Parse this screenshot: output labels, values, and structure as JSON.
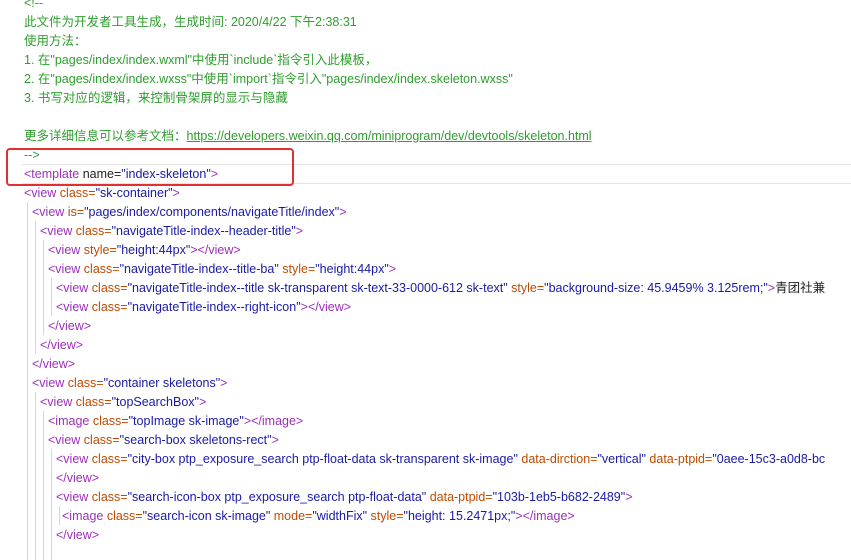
{
  "comment": {
    "open": "<!--",
    "line1": "此文件为开发者工具生成，生成时间: 2020/4/22 下午2:38:31",
    "line2": "使用方法：",
    "line3": "1. 在\"pages/index/index.wxml\"中使用`include`指令引入此模板，",
    "line4": "2. 在\"pages/index/index.wxss\"中使用`import`指令引入\"pages/index/index.skeleton.wxss\"",
    "line5": "3. 书写对应的逻辑，来控制骨架屏的显示与隐藏",
    "line6_prefix": "更多详细信息可以参考文档：",
    "line6_link": "https://developers.weixin.qq.com/miniprogram/dev/devtools/skeleton.html",
    "close": "-->"
  },
  "code": {
    "template_open": "<template",
    "template_attr": " name=",
    "template_value": "\"index-skeleton\"",
    "template_end": ">",
    "l1_tag": "<view",
    "l1_attr": " class=",
    "l1_val": "\"sk-container\"",
    "l1_end": ">",
    "l2_tag": "<view",
    "l2_attr": " is=",
    "l2_val": "\"pages/index/components/navigateTitle/index\"",
    "l2_end": ">",
    "l3_tag": "<view",
    "l3_attr": " class=",
    "l3_val": "\"navigateTitle-index--header-title\"",
    "l3_end": ">",
    "l4_tag": "<view",
    "l4_attr": " style=",
    "l4_val": "\"height:44px\"",
    "l4_end": "></view>",
    "l5_tag": "<view",
    "l5_attr": " class=",
    "l5_val": "\"navigateTitle-index--title-ba\"",
    "l5_attr2": " style=",
    "l5_val2": "\"height:44px\"",
    "l5_end": ">",
    "l6_tag": "<view",
    "l6_attr": " class=",
    "l6_val": "\"navigateTitle-index--title sk-transparent sk-text-33-0000-612 sk-text\"",
    "l6_attr2": " style=",
    "l6_val2": "\"background-size: 45.9459% 3.125rem;\"",
    "l6_end": ">",
    "l6_text": "青团社兼",
    "l7_tag": "<view",
    "l7_attr": " class=",
    "l7_val": "\"navigateTitle-index--right-icon\"",
    "l7_end": "></view>",
    "l8": "</view>",
    "l9": "</view>",
    "l10": "</view>",
    "l11_tag": "<view",
    "l11_attr": " class=",
    "l11_val": "\"container skeletons\"",
    "l11_end": ">",
    "l12_tag": "<view",
    "l12_attr": " class=",
    "l12_val": "\"topSearchBox\"",
    "l12_end": ">",
    "l13_tag": "<image",
    "l13_attr": " class=",
    "l13_val": "\"topImage sk-image\"",
    "l13_end": "></image>",
    "l14_tag": "<view",
    "l14_attr": " class=",
    "l14_val": "\"search-box skeletons-rect\"",
    "l14_end": ">",
    "l15_tag": "<view",
    "l15_attr": " class=",
    "l15_val": "\"city-box ptp_exposure_search ptp-float-data sk-transparent sk-image\"",
    "l15_attr2": " data-dirction=",
    "l15_val2": "\"vertical\"",
    "l15_attr3": " data-ptpid=",
    "l15_val3": "\"0aee-15c3-a0d8-bc",
    "l16": "</view>",
    "l17_tag": "<view",
    "l17_attr": " class=",
    "l17_val": "\"search-icon-box ptp_exposure_search ptp-float-data\"",
    "l17_attr2": " data-ptpid=",
    "l17_val2": "\"103b-1eb5-b682-2489\"",
    "l17_end": ">",
    "l18_tag": "<image",
    "l18_attr": " class=",
    "l18_val": "\"search-icon sk-image\"",
    "l18_attr2": " mode=",
    "l18_val2": "\"widthFix\"",
    "l18_attr3": " style=",
    "l18_val3": "\"height: 15.2471px;\"",
    "l18_end": "></image>",
    "l19": "</view>"
  },
  "colors": {
    "comment": "#2e9e2e",
    "tag": "#9b30b8",
    "attribute": "#c04a00",
    "string": "#1a1aa6",
    "highlight_box": "#e0302f"
  }
}
